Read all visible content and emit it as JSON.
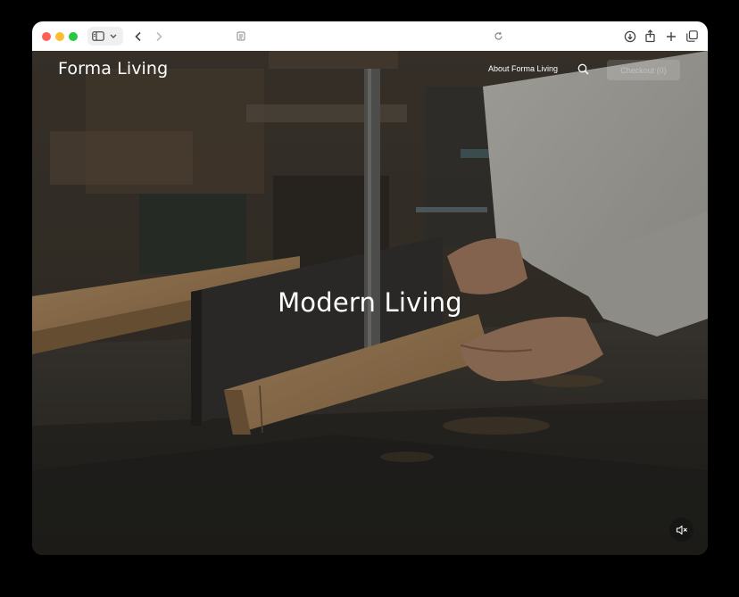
{
  "browser": {
    "address_icon": "page-icon",
    "icons": [
      "sidebar-icon",
      "chevron-down-icon",
      "back-chevron-icon",
      "forward-chevron-icon",
      "reload-icon",
      "download-icon",
      "share-icon",
      "plus-icon",
      "tabs-icon"
    ]
  },
  "site": {
    "brand": "Forma Living",
    "nav": {
      "about_label": "About Forma Living",
      "cta_label": "Checkout (0)"
    },
    "hero": {
      "headline": "Modern Living",
      "mute_icon": "speaker-muted-icon"
    }
  }
}
